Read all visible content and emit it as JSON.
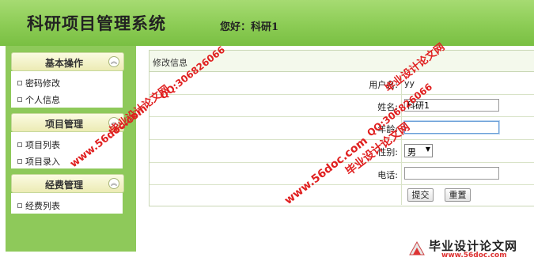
{
  "header": {
    "title": "科研项目管理系统",
    "greeting": "您好：科研1"
  },
  "sidebar": {
    "groups": [
      {
        "title": "基本操作",
        "items": [
          "密码修改",
          "个人信息"
        ]
      },
      {
        "title": "项目管理",
        "items": [
          "项目列表",
          "项目录入"
        ]
      },
      {
        "title": "经费管理",
        "items": [
          "经费列表"
        ]
      }
    ]
  },
  "form": {
    "title": "修改信息",
    "fields": {
      "username_label": "用户名:",
      "username_value": "yy",
      "name_label": "姓名:",
      "name_value": "科研1",
      "age_label": "年龄:",
      "age_value": "",
      "gender_label": "性别:",
      "gender_value": "男",
      "phone_label": "电话:",
      "phone_value": ""
    },
    "submit_label": "提交",
    "reset_label": "重置"
  },
  "watermarks": {
    "site_name": "毕业设计论文网",
    "qq": "QQ:306826066",
    "url": "www.56doc.com",
    "logo_text": "毕业设计论文网",
    "logo_url": "www.56doc.com"
  },
  "colors": {
    "header_green": "#8ccc55",
    "sidebar_green": "#8ec95a",
    "watermark_red": "#e02020"
  }
}
